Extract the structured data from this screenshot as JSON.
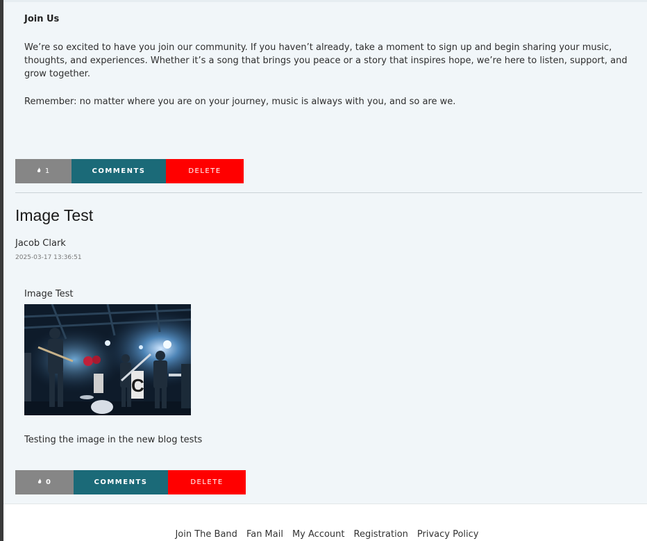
{
  "post1": {
    "heading": "Join Us",
    "paragraph1": "We’re so excited to have you join our community. If you haven’t already, take a moment to sign up and begin sharing your music, thoughts, and experiences. Whether it’s a song that brings you peace or a story that inspires hope, we’re here to listen, support, and grow together.",
    "paragraph2": "Remember: no matter where you are on your journey, music is always with you, and so are we.",
    "actions": {
      "like_icon": "flame-icon",
      "like_count": "1",
      "comments_label": "COMMENTS",
      "delete_label": "DELETE"
    }
  },
  "post2": {
    "title": "Image Test",
    "author": "Jacob Clark",
    "date": "2025-03-17 13:36:51",
    "image_caption": "Image Test",
    "image_description_icon": "concert-photo",
    "text": "Testing the image in the new blog tests",
    "actions": {
      "like_icon": "flame-icon",
      "like_count": "0",
      "comments_label": "COMMENTS",
      "delete_label": "DELETE"
    }
  },
  "footer": {
    "links": [
      "Join The Band",
      "Fan Mail",
      "My Account",
      "Registration",
      "Privacy Policy"
    ]
  },
  "colors": {
    "panel_bg": "#f1f6f9",
    "like_bg": "#868686",
    "comments_bg": "#1b6a78",
    "delete_bg": "#ff0000"
  }
}
